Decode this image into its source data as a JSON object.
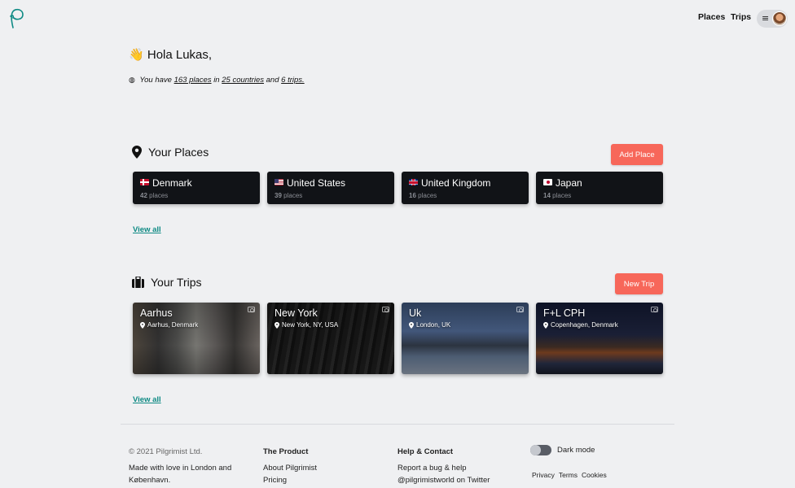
{
  "nav": {
    "places": "Places",
    "trips": "Trips",
    "menu_icon": "hamburger-icon"
  },
  "greeting": {
    "wave": "👋",
    "text": "Hola Lukas,"
  },
  "summary": {
    "prefix": "You have",
    "places": "163 places",
    "in": "in",
    "countries": "25 countries",
    "and": "and",
    "trips": "6 trips."
  },
  "places_section": {
    "title": "Your Places",
    "add_button": "Add Place",
    "view_all": "View all",
    "cards": [
      {
        "country": "Denmark",
        "count": "42",
        "unit": "places"
      },
      {
        "country": "United States",
        "count": "39",
        "unit": "places"
      },
      {
        "country": "United Kingdom",
        "count": "16",
        "unit": "places"
      },
      {
        "country": "Japan",
        "count": "14",
        "unit": "places"
      }
    ]
  },
  "trips_section": {
    "title": "Your Trips",
    "new_button": "New Trip",
    "view_all": "View all",
    "cards": [
      {
        "name": "Aarhus",
        "location": "Aarhus, Denmark"
      },
      {
        "name": "New York",
        "location": "New York, NY, USA"
      },
      {
        "name": "Uk",
        "location": "London, UK"
      },
      {
        "name": "F+L CPH",
        "location": "Copenhagen, Denmark"
      }
    ]
  },
  "footer": {
    "copyright": "© 2021 Pilgrimist Ltd.",
    "love_line1": "Made with love in London and",
    "love_line2": "København.",
    "product_head": "The Product",
    "about": "About Pilgrimist",
    "pricing": "Pricing",
    "help_head": "Help & Contact",
    "report": "Report a bug & help",
    "twitter": "@pilgrimistworld on Twitter",
    "dark_mode": "Dark mode",
    "privacy": "Privacy",
    "terms": "Terms",
    "cookies": "Cookies"
  },
  "colors": {
    "accent_red": "#f7675a",
    "link_teal": "#0e8a84",
    "card_dark": "#111317",
    "background": "#eff0f2"
  }
}
